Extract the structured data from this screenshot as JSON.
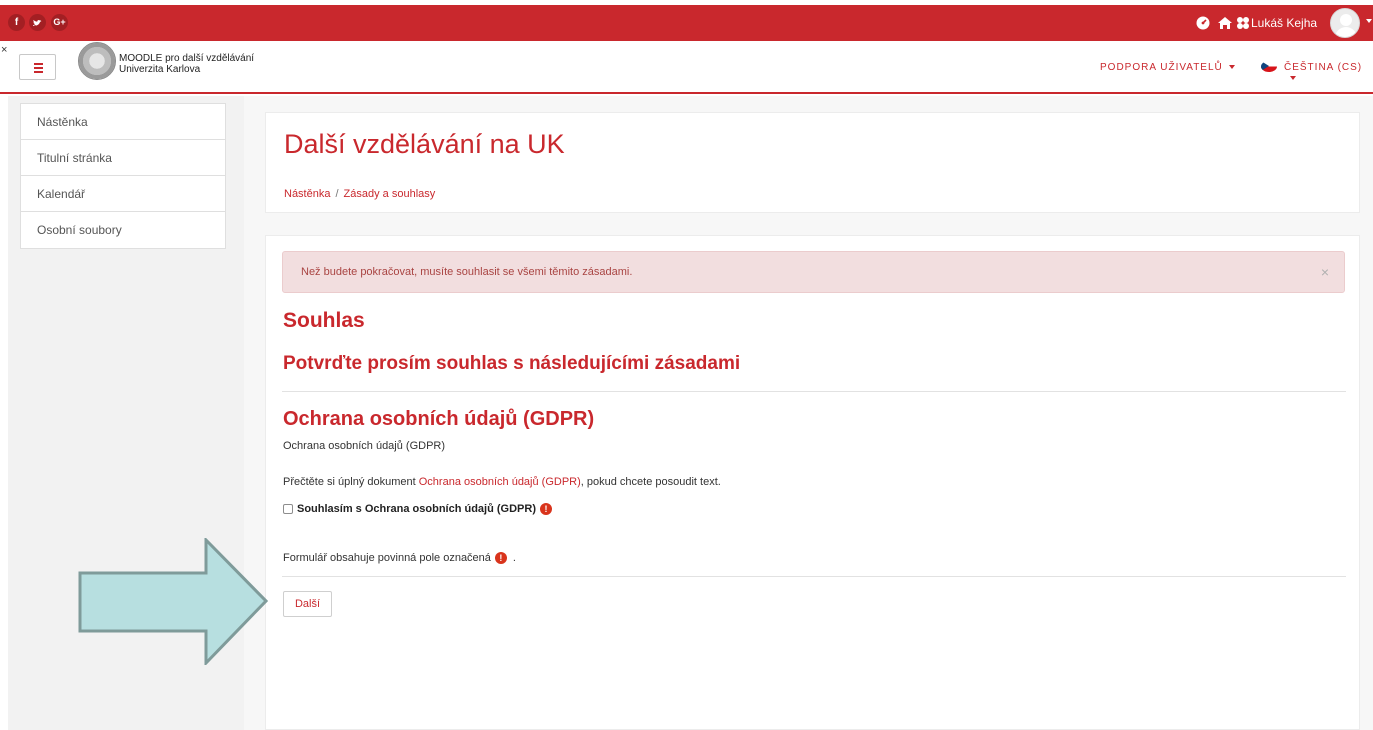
{
  "topbar": {
    "social": [
      {
        "icon": "facebook-icon",
        "glyph": "f"
      },
      {
        "icon": "twitter-icon",
        "glyph": "t"
      },
      {
        "icon": "google-plus-icon",
        "glyph": "G+"
      }
    ],
    "right_icons": [
      "dashboard-icon",
      "home-icon",
      "accessibility-icon"
    ],
    "username": "Lukáš Kejha",
    "color": "#c9282d"
  },
  "navbar": {
    "close_glyph": "×",
    "brand_line1": "MOODLE pro další vzdělávání",
    "brand_line2": "Univerzita Karlova",
    "support_label": "PODPORA UŽIVATELŮ",
    "language_label": "ČEŠTINA (CS)"
  },
  "sidebar": {
    "items": [
      {
        "label": "Nástěnka"
      },
      {
        "label": "Titulní stránka"
      },
      {
        "label": "Kalendář"
      },
      {
        "label": "Osobní soubory"
      }
    ]
  },
  "header": {
    "title": "Další vzdělávání na UK",
    "breadcrumb": [
      "Nástěnka",
      "Zásady a souhlasy"
    ],
    "breadcrumb_sep": "/"
  },
  "main": {
    "alert_text": "Než budete pokračovat, musíte souhlasit se všemi těmito zásadami.",
    "alert_close": "×",
    "heading": "Souhlas",
    "subheading": "Potvrďte prosím souhlas s následujícími zásadami",
    "policy_title": "Ochrana osobních údajů (GDPR)",
    "policy_summary": "Ochrana osobních údajů (GDPR)",
    "read_prefix": "Přečtěte si úplný dokument",
    "read_link": "Ochrana osobních údajů (GDPR)",
    "read_suffix": ", pokud chcete posoudit text.",
    "consent_label": "Souhlasím s Ochrana osobních údajů (GDPR)",
    "consent_checked": false,
    "required_glyph": "!",
    "form_note": "Formulář obsahuje povinná pole označená",
    "form_note_end": ".",
    "next_button": "Další"
  },
  "overlay": {
    "arrow_color": "#b7dfe0",
    "arrow_border": "#7f9b9a"
  }
}
